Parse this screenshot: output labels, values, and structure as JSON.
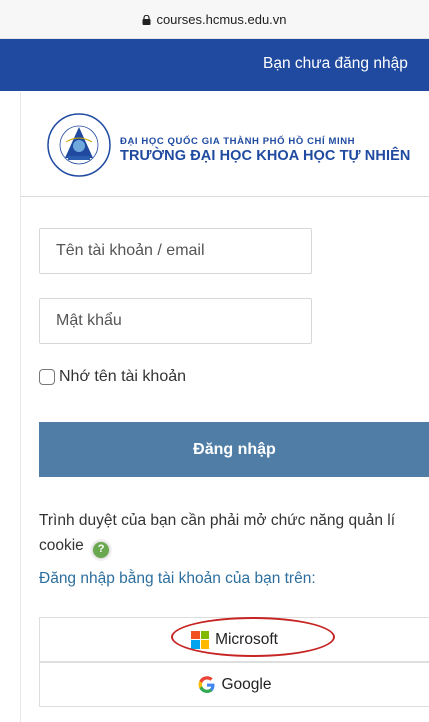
{
  "browser": {
    "url": "courses.hcmus.edu.vn"
  },
  "topnav": {
    "status_text": "Bạn chưa đăng nhập"
  },
  "university": {
    "line1": "ĐẠI HỌC QUỐC GIA THÀNH PHỐ HỒ CHÍ MINH",
    "line2": "TRƯỜNG ĐẠI HỌC KHOA HỌC TỰ NHIÊN",
    "seal_text_top": "ĐẠI HỌC KHOA HỌC TỰ NHIÊN",
    "seal_text_bottom": "TP. HỒ CHÍ MINH"
  },
  "login": {
    "username_placeholder": "Tên tài khoản / email",
    "password_placeholder": "Mật khẩu",
    "remember_label": "Nhớ tên tài khoản",
    "submit_label": "Đăng nhập"
  },
  "cookie": {
    "notice": "Trình duyệt của bạn cần phải mở chức năng quản lí cookie",
    "help_icon_glyph": "?"
  },
  "oauth": {
    "heading": "Đăng nhập bằng tài khoản của bạn trên:",
    "providers": [
      {
        "name": "Microsoft",
        "icon": "microsoft-logo-icon"
      },
      {
        "name": "Google",
        "icon": "google-logo-icon"
      }
    ]
  },
  "colors": {
    "topnav_bg": "#1f4aa0",
    "login_button_bg": "#4f7da6",
    "link_color": "#2c6f9e",
    "annotation_red": "#c72424"
  }
}
